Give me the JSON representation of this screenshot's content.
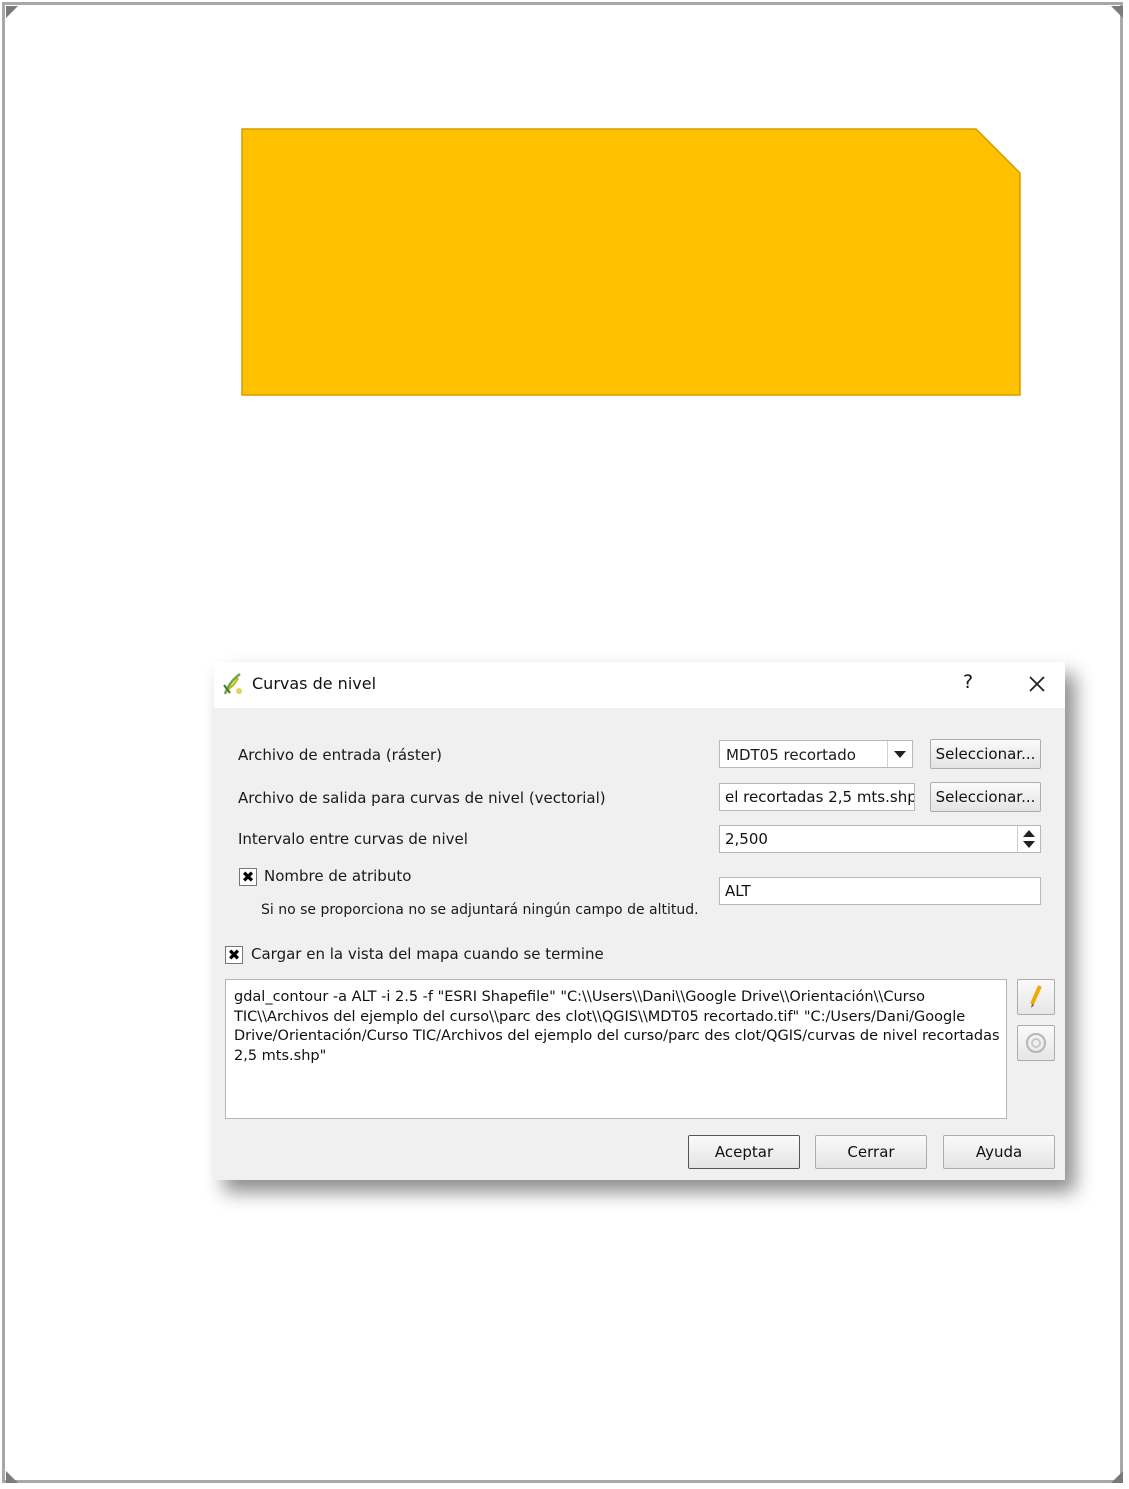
{
  "dialog": {
    "title": "Curvas de nivel",
    "help_label": "?",
    "input_raster": {
      "label": "Archivo de entrada (ráster)",
      "value": "MDT05 recortado",
      "browse_label": "Seleccionar..."
    },
    "output_vector": {
      "label": "Archivo de salida para curvas de nivel (vectorial)",
      "value": "el recortadas 2,5 mts.shp",
      "browse_label": "Seleccionar..."
    },
    "interval": {
      "label": "Intervalo entre curvas de nivel",
      "value": "2,500"
    },
    "attribute": {
      "checked": true,
      "label": "Nombre de atributo",
      "value": "ALT",
      "hint": "Si no se proporciona no se adjuntará ningún campo de altitud."
    },
    "load_in_map": {
      "checked": true,
      "label": "Cargar en la vista del mapa cuando se termine"
    },
    "command_lines": [
      "gdal_contour -a ALT -i 2.5 -f \"ESRI Shapefile\" \"C:\\\\Users\\\\Dani\\\\Google Drive\\\\Orientación\\\\Curso",
      "TIC\\\\Archivos del ejemplo del curso\\\\parc des clot\\\\QGIS\\\\MDT05 recortado.tif\" \"C:/Users/Dani/Google",
      "Drive/Orientación/Curso TIC/Archivos del ejemplo del curso/parc des clot/QGIS/curvas de nivel recortadas",
      "2,5 mts.shp\""
    ],
    "buttons": {
      "ok": "Aceptar",
      "close": "Cerrar",
      "help": "Ayuda"
    }
  },
  "colors": {
    "yellow_shape": "#FFC000",
    "dialog_bg": "#f0f0f0"
  }
}
